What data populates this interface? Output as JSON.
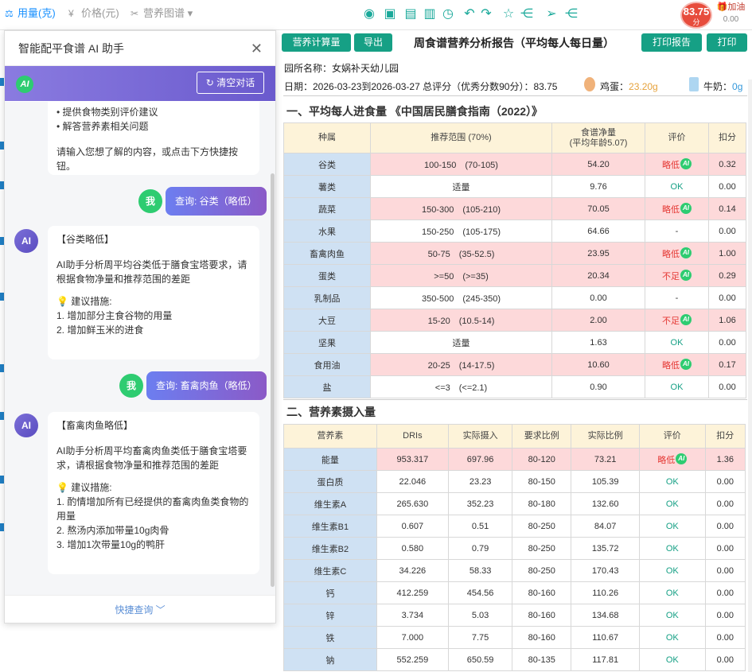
{
  "tabs": [
    {
      "label": "用量(克)",
      "icon": "scale-icon"
    },
    {
      "label": "价格(元)",
      "icon": "yen-icon"
    },
    {
      "label": "营养图谱",
      "icon": "nutrition-icon"
    }
  ],
  "score": {
    "value": "83.75",
    "unit": "分"
  },
  "boost": {
    "label": "加油",
    "value": "0.00"
  },
  "chat": {
    "title": "智能配平食谱 AI 助手",
    "clear_label": "清空对话",
    "intro_items": [
      "• 提供食物类别评价建议",
      "• 解答营养素相关问题"
    ],
    "intro_prompt": "请输入您想了解的内容，或点击下方快捷按钮。",
    "me_label": "我",
    "ai_label": "AI",
    "q1": "查询: 谷类（略低）",
    "a1": {
      "heading": "【谷类略低】",
      "body": "AI助手分析周平均谷类低于膳食宝塔要求，请根据食物净量和推荐范围的差距",
      "tip": "💡 建议措施:",
      "items": [
        "1. 增加部分主食谷物的用量",
        "2. 增加鲜玉米的进食"
      ]
    },
    "q2": "查询: 畜禽肉鱼（略低）",
    "a2": {
      "heading": "【畜禽肉鱼略低】",
      "body": "AI助手分析周平均畜禽肉鱼类低于膳食宝塔要求，请根据食物净量和推荐范围的差距",
      "tip": "💡 建议措施:",
      "items": [
        "1. 酌情增加所有已经提供的畜禽肉鱼类食物的用量",
        "2. 熬汤内添加带量10g肉骨",
        "3. 增加1次带量10g的鸭肝"
      ]
    },
    "quick": "快捷查询 ﹀"
  },
  "buttons": {
    "calc": "营养计算量",
    "export": "导出",
    "print_report": "打印报告",
    "print": "打印"
  },
  "report": {
    "title": "周食谱营养分析报告（平均每人每日量）",
    "school": "园所名称：女娲补天幼儿园",
    "date_score": "日期：2026-03-23到2026-03-27 总评分（优秀分数90分）：83.75",
    "egg_label": "鸡蛋：",
    "egg_value": "23.20g",
    "milk_label": "牛奶：",
    "milk_value": "0g"
  },
  "section1": {
    "title": "一、平均每人进食量 《中国居民膳食指南（2022）》",
    "headers": [
      "种属",
      "推荐范围 (70%)",
      "食谱净量\n(平均年龄5.07)",
      "评价",
      "扣分"
    ],
    "rows": [
      {
        "name": "谷类",
        "range": "100-150　(70-105)",
        "net": "54.20",
        "eval": "略低",
        "ai": true,
        "deduct": "0.32",
        "low": true
      },
      {
        "name": "薯类",
        "range": "适量",
        "net": "9.76",
        "eval": "OK",
        "ai": false,
        "deduct": "0.00",
        "low": false
      },
      {
        "name": "蔬菜",
        "range": "150-300　(105-210)",
        "net": "70.05",
        "eval": "略低",
        "ai": true,
        "deduct": "0.14",
        "low": true
      },
      {
        "name": "水果",
        "range": "150-250　(105-175)",
        "net": "64.66",
        "eval": "-",
        "ai": false,
        "deduct": "0.00",
        "low": false
      },
      {
        "name": "畜禽肉鱼",
        "range": "50-75　(35-52.5)",
        "net": "23.95",
        "eval": "略低",
        "ai": true,
        "deduct": "1.00",
        "low": true
      },
      {
        "name": "蛋类",
        "range": ">=50　(>=35)",
        "net": "20.34",
        "eval": "不足",
        "ai": true,
        "deduct": "0.29",
        "low": true
      },
      {
        "name": "乳制品",
        "range": "350-500　(245-350)",
        "net": "0.00",
        "eval": "-",
        "ai": false,
        "deduct": "0.00",
        "low": false
      },
      {
        "name": "大豆",
        "range": "15-20　(10.5-14)",
        "net": "2.00",
        "eval": "不足",
        "ai": true,
        "deduct": "1.06",
        "low": true
      },
      {
        "name": "坚果",
        "range": "适量",
        "net": "1.63",
        "eval": "OK",
        "ai": false,
        "deduct": "0.00",
        "low": false
      },
      {
        "name": "食用油",
        "range": "20-25　(14-17.5)",
        "net": "10.60",
        "eval": "略低",
        "ai": true,
        "deduct": "0.17",
        "low": true
      },
      {
        "name": "盐",
        "range": "<=3　(<=2.1)",
        "net": "0.90",
        "eval": "OK",
        "ai": false,
        "deduct": "0.00",
        "low": false
      }
    ]
  },
  "section2": {
    "title": "二、营养素摄入量",
    "headers": [
      "营养素",
      "DRIs",
      "实际摄入",
      "要求比例",
      "实际比例",
      "评价",
      "扣分"
    ],
    "rows": [
      {
        "name": "能量",
        "dri": "953.317",
        "actual": "697.96",
        "req": "80-120",
        "ratio": "73.21",
        "eval": "略低",
        "ai": true,
        "deduct": "1.36",
        "low": true
      },
      {
        "name": "蛋白质",
        "dri": "22.046",
        "actual": "23.23",
        "req": "80-150",
        "ratio": "105.39",
        "eval": "OK",
        "ai": false,
        "deduct": "0.00",
        "low": false
      },
      {
        "name": "维生素A",
        "dri": "265.630",
        "actual": "352.23",
        "req": "80-180",
        "ratio": "132.60",
        "eval": "OK",
        "ai": false,
        "deduct": "0.00",
        "low": false
      },
      {
        "name": "维生素B1",
        "dri": "0.607",
        "actual": "0.51",
        "req": "80-250",
        "ratio": "84.07",
        "eval": "OK",
        "ai": false,
        "deduct": "0.00",
        "low": false
      },
      {
        "name": "维生素B2",
        "dri": "0.580",
        "actual": "0.79",
        "req": "80-250",
        "ratio": "135.72",
        "eval": "OK",
        "ai": false,
        "deduct": "0.00",
        "low": false
      },
      {
        "name": "维生素C",
        "dri": "34.226",
        "actual": "58.33",
        "req": "80-250",
        "ratio": "170.43",
        "eval": "OK",
        "ai": false,
        "deduct": "0.00",
        "low": false
      },
      {
        "name": "钙",
        "dri": "412.259",
        "actual": "454.56",
        "req": "80-160",
        "ratio": "110.26",
        "eval": "OK",
        "ai": false,
        "deduct": "0.00",
        "low": false
      },
      {
        "name": "锌",
        "dri": "3.734",
        "actual": "5.03",
        "req": "80-160",
        "ratio": "134.68",
        "eval": "OK",
        "ai": false,
        "deduct": "0.00",
        "low": false
      },
      {
        "name": "铁",
        "dri": "7.000",
        "actual": "7.75",
        "req": "80-160",
        "ratio": "110.67",
        "eval": "OK",
        "ai": false,
        "deduct": "0.00",
        "low": false
      },
      {
        "name": "钠",
        "dri": "552.259",
        "actual": "650.59",
        "req": "80-135",
        "ratio": "117.81",
        "eval": "OK",
        "ai": false,
        "deduct": "0.00",
        "low": false
      }
    ]
  }
}
